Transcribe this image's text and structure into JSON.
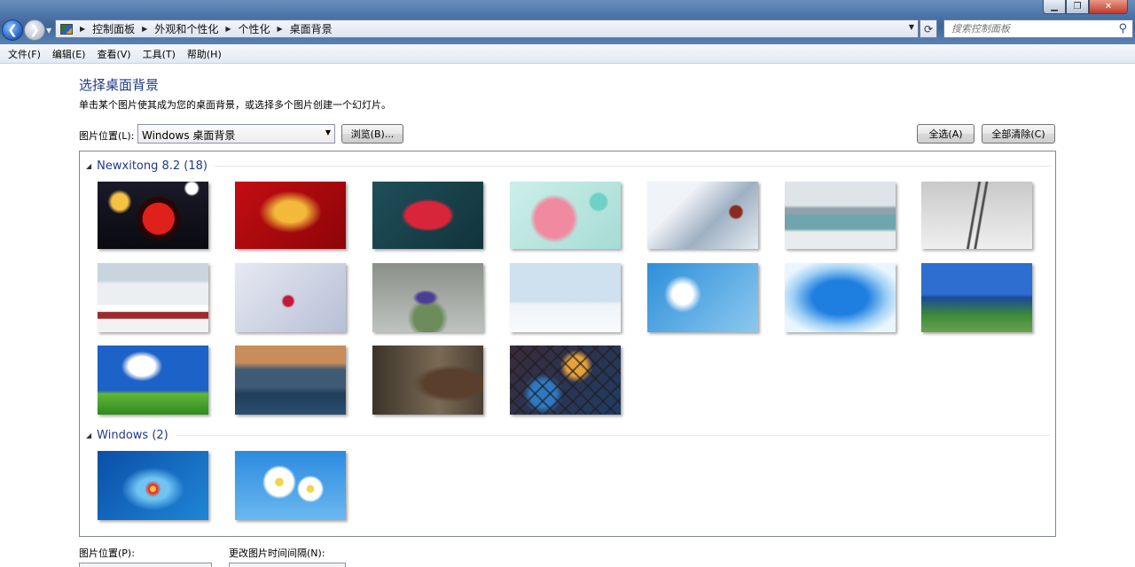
{
  "window": {
    "minimize": "▁",
    "maximize": "❐",
    "close": "✕"
  },
  "address": {
    "crumbs": [
      "控制面板",
      "外观和个性化",
      "个性化",
      "桌面背景"
    ],
    "search_placeholder": "搜索控制面板"
  },
  "menu": [
    "文件(F)",
    "编辑(E)",
    "查看(V)",
    "工具(T)",
    "帮助(H)"
  ],
  "header": {
    "title": "选择桌面背景",
    "description": "单击某个图片使其成为您的桌面背景，或选择多个图片创建一个幻灯片。",
    "location_label": "图片位置(L):",
    "location_value": "Windows 桌面背景",
    "browse_label": "浏览(B)...",
    "select_all_label": "全选(A)",
    "clear_all_label": "全部清除(C)"
  },
  "groups": [
    {
      "title": "Newxitong 8.2 (18)",
      "thumbs": [
        {
          "name": "fu-lantern-night",
          "bg": "radial-gradient(circle at 55% 55%, #e0201a 0 22%, #2a0505 23% 30%, transparent 31%), radial-gradient(circle at 20% 30%, #f6c243 0 8%, transparent 12%), radial-gradient(circle at 85% 10%, #fff 0 5%, transparent 7%), linear-gradient(#1a1a2a, #0a0a10)"
        },
        {
          "name": "red-2018-gold",
          "bg": "radial-gradient(ellipse at 50% 45%, #f2b93a 0 20%, transparent 40%), linear-gradient(135deg, #c30d12, #8d0508)"
        },
        {
          "name": "teal-2018-red",
          "bg": "radial-gradient(ellipse at 50% 50%, #d8253a 0 28%, transparent 34%), linear-gradient(135deg, #1f4f5a, #12333b)"
        },
        {
          "name": "pink-candy-flatlay",
          "bg": "radial-gradient(circle at 40% 55%, #f08aa0 0 25%, transparent 32%), radial-gradient(circle at 80% 30%, #6fd1c6 0 8%, transparent 10%), linear-gradient(135deg, #cdeee9, #a6dcd5)"
        },
        {
          "name": "snow-ornament-branch",
          "bg": "radial-gradient(circle at 80% 45%, #8b2a20 0 6%, transparent 8%), linear-gradient(135deg, #f0f3f7 30%, #9eb0c2 60%, #e5ebf1)"
        },
        {
          "name": "snowy-bridge-lake",
          "bg": "linear-gradient(180deg, #dfe4e9 0 35%, #8fa3ae 40% 48%, #6fa5ad 50% 70%, #e8ecef 75%)"
        },
        {
          "name": "snowy-railway",
          "bg": "linear-gradient(100deg, transparent 46%, #4a4a4a 47% 48%, transparent 49% 52%, #4a4a4a 53% 54%, transparent 55%), linear-gradient(180deg, #c9c9c9, #efefef)"
        },
        {
          "name": "snow-train-mountain",
          "bg": "linear-gradient(180deg, #c9d4df 0 25%, #eceff2 30% 60%, transparent 61%), linear-gradient(180deg, transparent 70%, #9d2b2b 71% 80%, #f2f2f2 81%)"
        },
        {
          "name": "red-berries-frost",
          "bg": "radial-gradient(circle at 48% 55%, #c2183a 0 7%, transparent 10%), linear-gradient(135deg, #e7e9f2, #b7bfd6)"
        },
        {
          "name": "purple-crocus-snow",
          "bg": "radial-gradient(ellipse at 48% 50%, #4c3d96 0 10%, transparent 16%), radial-gradient(ellipse at 50% 80%, #6d8c5b 0 18%, transparent 26%), linear-gradient(180deg, #8b8f89, #bfc3bf)"
        },
        {
          "name": "soft-snow-bokeh",
          "bg": "linear-gradient(180deg, #cfe0ee 0 55%, #eef3f8 60%, #f8fbfd)"
        },
        {
          "name": "blue-snowflake",
          "bg": "radial-gradient(circle at 32% 45%, #ffffff 0 12%, transparent 22%), linear-gradient(135deg, #2d8fd9, #8cc8ef)"
        },
        {
          "name": "blue-frost-frame",
          "bg": "radial-gradient(ellipse at 50% 50%, #1f7fe0 0 35%, #9fd0f5 60%, #eaf6ff 80%)"
        },
        {
          "name": "wind-turbine-coast",
          "bg": "linear-gradient(180deg, #2d6ed0 0 45%, #1c4a9a 50%, #3c8a3a 75%, #6aa24e)"
        },
        {
          "name": "blue-sky-grass",
          "bg": "radial-gradient(ellipse at 40% 30%, #ffffff 0 14%, transparent 22%), linear-gradient(180deg, #1d62c6 0 65%, #5fb836 70%, #2f8a1f)"
        },
        {
          "name": "lakeside-village",
          "bg": "linear-gradient(180deg, #c98d5b 0 25%, #3f5a74 35% 60%, #1f3e5a 70%, #2a4f6e)"
        },
        {
          "name": "woman-window-bokeh",
          "bg": "radial-gradient(ellipse at 72% 55%, #5a3f2d 0 25%, transparent 35%), linear-gradient(90deg, #3c3428, #7a6a55 60%, #4b3f33)"
        },
        {
          "name": "chainlink-bokeh",
          "bg": "repeating-linear-gradient(45deg, rgba(30,30,30,0.6) 0 2px, transparent 2px 12px), repeating-linear-gradient(-45deg, rgba(30,30,30,0.6) 0 2px, transparent 2px 12px), radial-gradient(circle at 60% 30%, #e6a13a 0 12%, transparent 20%), radial-gradient(circle at 30% 70%, #2e7ac2 0 14%, transparent 22%), linear-gradient(135deg, #3a2a3a, #1f3c66)"
        }
      ]
    },
    {
      "title": "Windows (2)",
      "thumbs": [
        {
          "name": "windows7-default",
          "bg": "radial-gradient(circle at 50% 55%, #f4c542 0 4%, #e63b2b 5% 7%, transparent 12%), radial-gradient(ellipse at 50% 55%, #6fc4f2 0 20%, transparent 40%), linear-gradient(135deg, #0b4fa8, #1f86d6)"
        },
        {
          "name": "daisies-blue-sky",
          "bg": "radial-gradient(circle at 40% 45%, #f2d34a 0 5%, #ffffff 6% 18%, transparent 22%), radial-gradient(circle at 68% 55%, #f2d34a 0 4%, #ffffff 5% 13%, transparent 16%), linear-gradient(180deg, #2c8be0, #6ab8ef)"
        }
      ]
    }
  ],
  "footer": {
    "position_label": "图片位置(P):",
    "interval_label": "更改图片时间间隔(N):"
  }
}
